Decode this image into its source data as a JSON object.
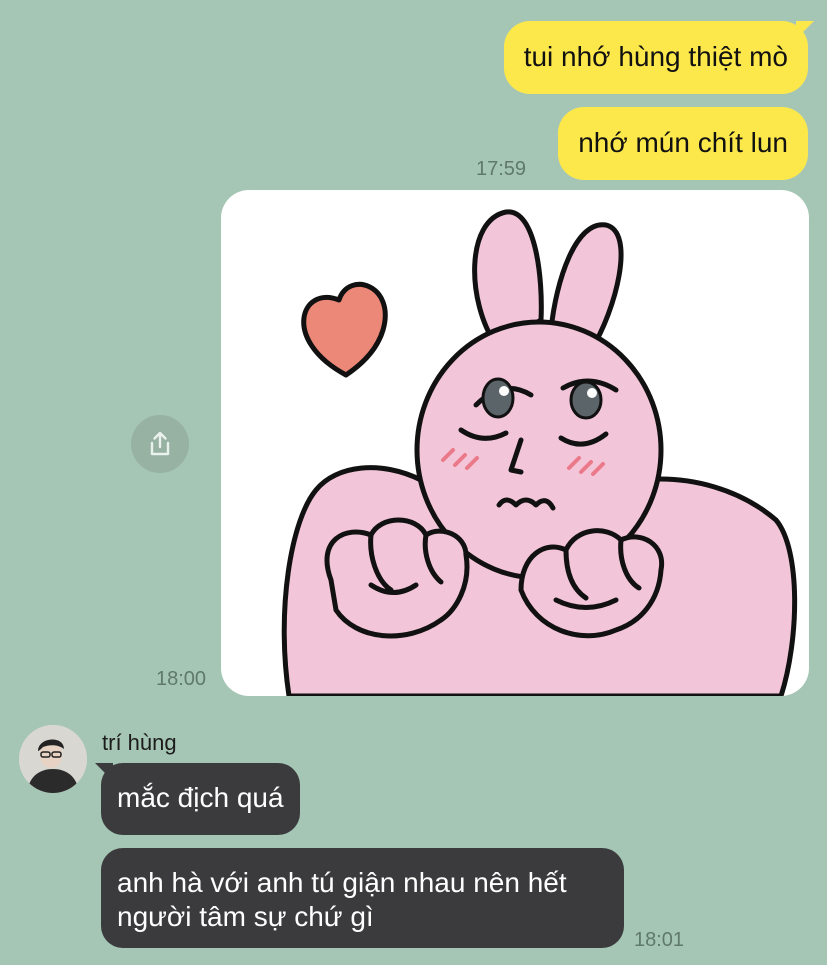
{
  "outgoing": [
    {
      "text": "tui nhớ hùng thiệt mò"
    },
    {
      "text": "nhớ mún chít lun"
    }
  ],
  "outgoing_time": "17:59",
  "sticker": {
    "icon": "pink-rabbit-heart-sticker",
    "time": "18:00",
    "share_icon": "share-icon"
  },
  "incoming": {
    "sender": "trí hùng",
    "messages": [
      {
        "text": "mắc địch quá"
      },
      {
        "text": "anh hà với anh tú giận nhau nên hết người tâm sự chứ gì"
      }
    ],
    "time": "18:01"
  },
  "colors": {
    "background": "#a6c6b5",
    "outgoing_bubble": "#fde84c",
    "incoming_bubble": "#3b3b3d"
  }
}
